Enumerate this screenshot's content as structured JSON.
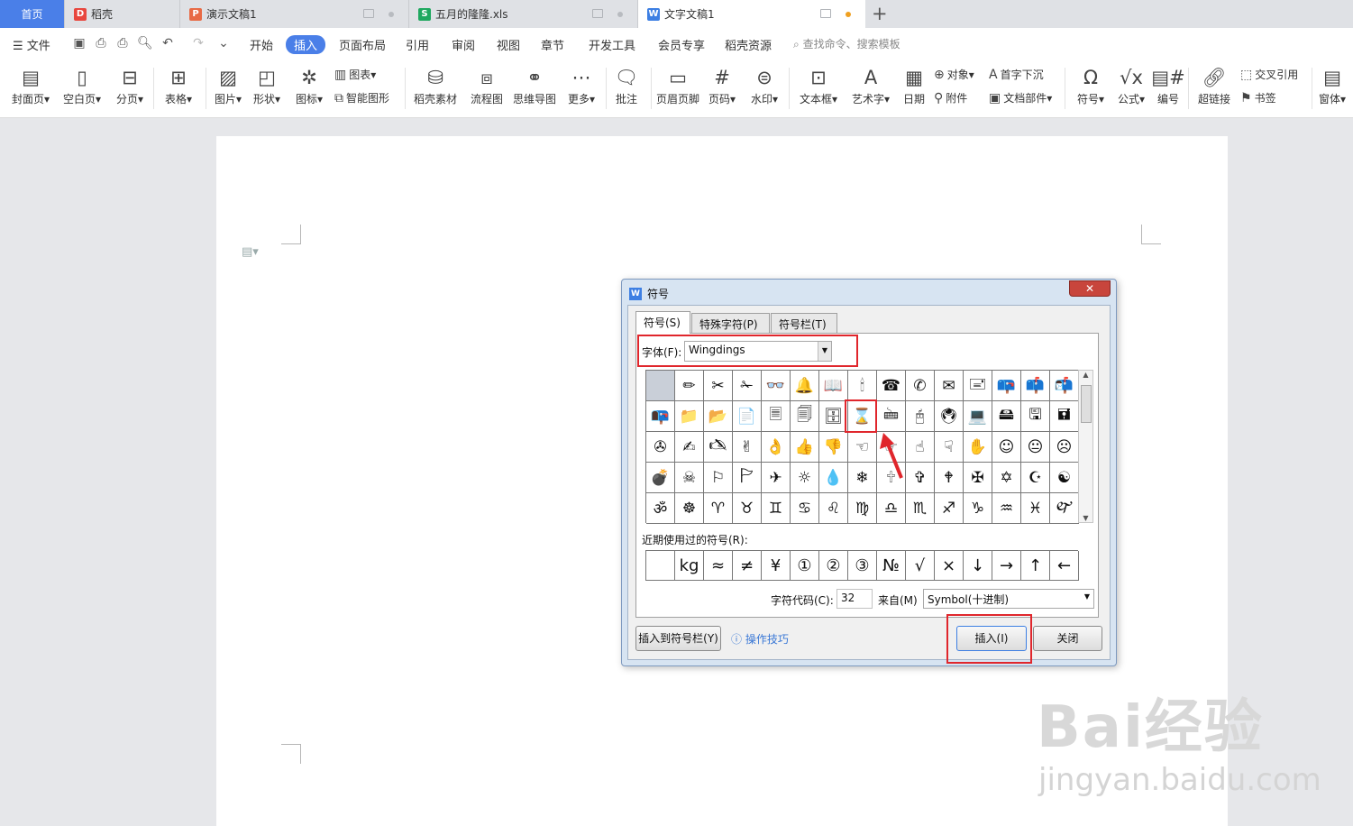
{
  "tabs": [
    {
      "label": "首页"
    },
    {
      "label": "稻壳",
      "icon": "docer-icon",
      "color": "#e8473e"
    },
    {
      "label": "演示文稿1",
      "icon": "presentation-icon",
      "color": "#e86a45"
    },
    {
      "label": "五月的隆隆.xls",
      "icon": "spreadsheet-icon",
      "color": "#1fa85f"
    },
    {
      "label": "文字文稿1",
      "icon": "writer-icon",
      "color": "#3d7fe3"
    }
  ],
  "menubar": {
    "file": "文件",
    "items": [
      "开始",
      "插入",
      "页面布局",
      "引用",
      "审阅",
      "视图",
      "章节",
      "开发工具",
      "会员专享",
      "稻壳资源"
    ],
    "active": "插入",
    "search": "查找命令、搜索模板"
  },
  "ribbon": {
    "cover": "封面页",
    "blank": "空白页",
    "pagebreak": "分页",
    "table": "表格",
    "picture": "图片",
    "shape": "形状",
    "iconlib": "图标",
    "chart": "图表",
    "smartart": "智能图形",
    "material": "稻壳素材",
    "flow": "流程图",
    "mindmap": "思维导图",
    "more": "更多",
    "comment": "批注",
    "headerfooter": "页眉页脚",
    "pagenum": "页码",
    "watermark": "水印",
    "textbox": "文本框",
    "wordart": "艺术字",
    "date": "日期",
    "object": "对象",
    "attach": "附件",
    "dropcap": "首字下沉",
    "docpart": "文档部件",
    "symbol": "符号",
    "formula": "公式",
    "numbering": "编号",
    "hyperlink": "超链接",
    "crossref": "交叉引用",
    "bookmark": "书签",
    "window": "窗体"
  },
  "dialog": {
    "title": "符号",
    "close": "✕",
    "tabs": [
      "符号(S)",
      "特殊字符(P)",
      "符号栏(T)"
    ],
    "font_label": "字体(F):",
    "font_value": "Wingdings",
    "symbols": [
      "",
      "✏",
      "✂",
      "✁",
      "👓",
      "🔔",
      "📖",
      "🕯",
      "☎",
      "✆",
      "✉",
      "🖃",
      "📪",
      "📫",
      "📬",
      "📭",
      "📁",
      "📂",
      "📄",
      "🗏",
      "🗐",
      "🗄",
      "⌛",
      "🖮",
      "🖰",
      "🖲",
      "💻",
      "🖴",
      "🖫",
      "🖬",
      "✇",
      "✍",
      "🖎",
      "✌",
      "👌",
      "👍",
      "👎",
      "☜",
      "☞",
      "☝",
      "☟",
      "✋",
      "☺",
      "😐",
      "☹",
      "💣",
      "☠",
      "⚐",
      "🏱",
      "✈",
      "☼",
      "💧",
      "❄",
      "🕆",
      "✞",
      "🕈",
      "✠",
      "✡",
      "☪",
      "☯",
      "ॐ",
      "☸",
      "♈",
      "♉",
      "♊",
      "♋",
      "♌",
      "♍",
      "♎",
      "♏",
      "♐",
      "♑",
      "♒",
      "♓",
      "🙰"
    ],
    "recent_label": "近期使用过的符号(R):",
    "recent": [
      "",
      "kg",
      "≈",
      "≠",
      "¥",
      "①",
      "②",
      "③",
      "№",
      "√",
      "×",
      "↓",
      "→",
      "↑",
      "←"
    ],
    "charcode_label": "字符代码(C):",
    "charcode_value": "32",
    "from_label": "来自(M)",
    "from_value": "Symbol(十进制)",
    "insert_to_bar": "插入到符号栏(Y)",
    "tips": "操作技巧",
    "insert": "插入(I)",
    "close_btn": "关闭"
  },
  "watermark": {
    "main": "Bai经验",
    "sub": "jingyan.baidu.com"
  }
}
